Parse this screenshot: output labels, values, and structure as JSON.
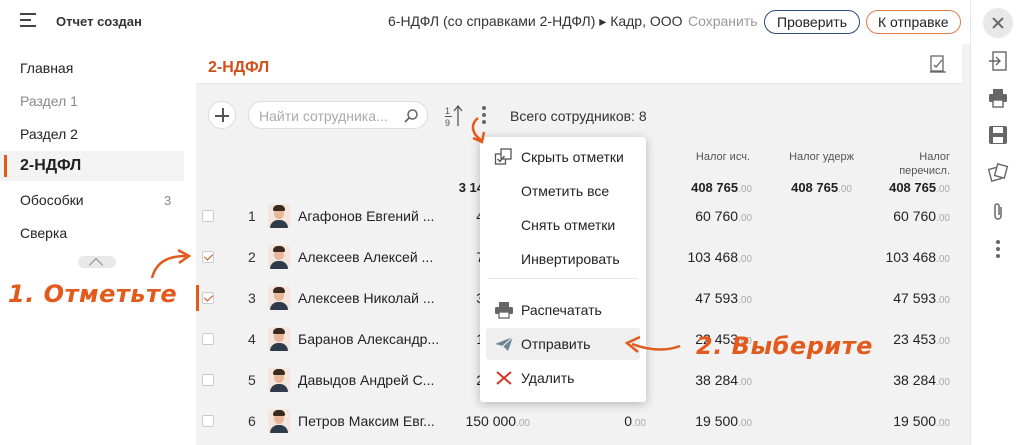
{
  "topbar": {
    "status": "Отчет создан",
    "doc_title": "6-НДФЛ (со справками 2-НДФЛ) ▸ Кадр, ООО",
    "save_label": "Сохранить",
    "check_label": "Проверить",
    "send_label": "К отправке"
  },
  "sidebar": {
    "items": [
      {
        "label": "Главная"
      },
      {
        "label": "Раздел 1"
      },
      {
        "label": "Раздел 2"
      },
      {
        "label": "2-НДФЛ"
      },
      {
        "label": "Обособки",
        "count": "3"
      },
      {
        "label": "Сверка"
      }
    ]
  },
  "section": {
    "title": "2-НДФЛ"
  },
  "toolbar": {
    "search_placeholder": "Найти сотрудника...",
    "sort_label_top": "1",
    "sort_label_bottom": "9",
    "total_label": "Всего сотрудников: 8"
  },
  "table": {
    "columns": {
      "tax_calc": "Налог исч.",
      "tax_withheld": "Налог удерж",
      "tax_paid_line1": "Налог",
      "tax_paid_line2": "перечисл."
    },
    "totals": {
      "income_partial": "3 14",
      "tax_calc": "408 765",
      "tax_calc_dec": ".00",
      "tax_withheld": "408 765",
      "tax_withheld_dec": ".00",
      "tax_paid": "408 765",
      "tax_paid_dec": ".00"
    },
    "rows": [
      {
        "num": "1",
        "name": "Агафонов Евгений ...",
        "income_partial": "4",
        "tax_calc": "60 760",
        "tax_calc_dec": ".00",
        "tax_paid": "60 760",
        "tax_paid_dec": ".00",
        "checked": false
      },
      {
        "num": "2",
        "name": "Алексеев Алексей ...",
        "income_partial": "7",
        "tax_calc": "103 468",
        "tax_calc_dec": ".00",
        "tax_paid": "103 468",
        "tax_paid_dec": ".00",
        "checked": true
      },
      {
        "num": "3",
        "name": "Алексеев Николай ...",
        "income_partial": "3",
        "tax_calc": "47 593",
        "tax_calc_dec": ".00",
        "tax_paid": "47 593",
        "tax_paid_dec": ".00",
        "checked": true
      },
      {
        "num": "4",
        "name": "Баранов Александр...",
        "income_partial": "1",
        "tax_calc": "22 453",
        "tax_calc_dec": ".00",
        "tax_paid": "23 453",
        "tax_paid_dec": ".00",
        "checked": false
      },
      {
        "num": "5",
        "name": "Давыдов Андрей С...",
        "income_partial": "2",
        "tax_calc": "38 284",
        "tax_calc_dec": ".00",
        "tax_paid": "38 284",
        "tax_paid_dec": ".00",
        "checked": false
      },
      {
        "num": "6",
        "name": "Петров Максим Евг...",
        "income": "150 000",
        "income_dec": ".00",
        "deduction": "0",
        "deduction_dec": ".00",
        "tax_calc": "19 500",
        "tax_calc_dec": ".00",
        "tax_paid": "19 500",
        "tax_paid_dec": ".00",
        "checked": false
      }
    ]
  },
  "menu": {
    "items": [
      {
        "label": "Скрыть отметки",
        "icon": "hide-marks-icon"
      },
      {
        "label": "Отметить все"
      },
      {
        "label": "Снять отметки"
      },
      {
        "label": "Инвертировать"
      },
      {
        "label": "Распечатать",
        "icon": "printer-icon"
      },
      {
        "label": "Отправить",
        "icon": "send-icon"
      },
      {
        "label": "Удалить",
        "icon": "delete-icon"
      }
    ]
  },
  "annotations": {
    "step1": "1. Отметьте",
    "step2": "2. Выберите"
  },
  "colors": {
    "accent": "#e25a1c",
    "button_border": "#2b4a80"
  }
}
